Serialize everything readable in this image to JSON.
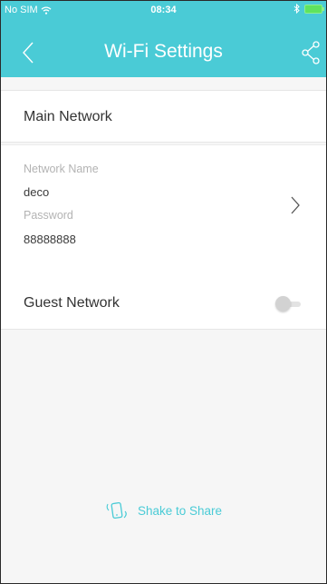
{
  "status_bar": {
    "carrier": "No SIM",
    "time": "08:34"
  },
  "nav": {
    "title": "Wi-Fi Settings"
  },
  "main_network": {
    "title": "Main Network",
    "name_label": "Network Name",
    "name_value": "deco",
    "password_label": "Password",
    "password_value": "88888888"
  },
  "guest_network": {
    "label": "Guest Network",
    "enabled": false
  },
  "shake": {
    "label": "Shake to Share"
  },
  "colors": {
    "accent": "#4acbd6",
    "background": "#f6f6f6"
  },
  "icons": {
    "back": "chevron-left-icon",
    "share": "share-icon",
    "wifi": "wifi-icon",
    "bluetooth": "bluetooth-icon",
    "battery": "battery-icon",
    "chevron": "chevron-right-icon",
    "shake": "shake-phone-icon"
  }
}
